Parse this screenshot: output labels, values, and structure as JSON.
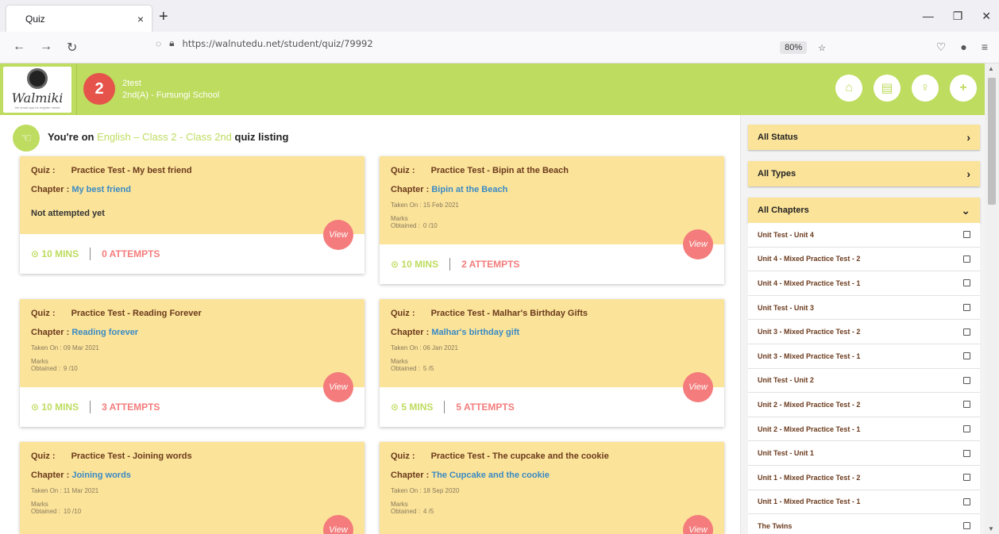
{
  "browser": {
    "tab_title": "Quiz",
    "close_glyph": "×",
    "new_tab_glyph": "+",
    "url": "https://walnutedu.net/student/quiz/79992",
    "zoom": "80%"
  },
  "header": {
    "logo_text": "Walmiki",
    "logo_tagline": "the smart app for brighter minds",
    "grade": "2",
    "student_name": "2test",
    "student_class": "2nd(A) - Fursungi School"
  },
  "breadcrumb": {
    "prefix": "You're on",
    "highlight": "English – Class 2 - Class 2nd",
    "suffix": "quiz listing"
  },
  "labels": {
    "quiz": "Quiz :",
    "chapter": "Chapter :",
    "taken_on": "Taken On :",
    "marks_line1": "Marks",
    "marks_line2": "Obtained :",
    "view": "View",
    "not_attempted": "Not attempted yet"
  },
  "quizzes": [
    {
      "title": "Practice Test - My best friend",
      "chapter": "My best friend",
      "taken_on": "",
      "marks": "",
      "mins": "⊙ 10 MINS",
      "attempts": "0 ATTEMPTS"
    },
    {
      "title": "Practice Test - Bipin at the Beach",
      "chapter": "Bipin at the Beach",
      "taken_on": "15 Feb 2021",
      "marks": "0 /10",
      "mins": "⊙ 10 MINS",
      "attempts": "2 ATTEMPTS"
    },
    {
      "title": "Practice Test - Reading Forever",
      "chapter": "Reading forever",
      "taken_on": "09 Mar 2021",
      "marks": "9 /10",
      "mins": "⊙ 10 MINS",
      "attempts": "3 ATTEMPTS"
    },
    {
      "title": "Practice Test - Malhar's Birthday Gifts",
      "chapter": "Malhar's birthday gift",
      "taken_on": "06 Jan 2021",
      "marks": "5 /5",
      "mins": "⊙ 5 MINS",
      "attempts": "5 ATTEMPTS"
    },
    {
      "title": "Practice Test - Joining words",
      "chapter": "Joining words",
      "taken_on": "11 Mar 2021",
      "marks": "10 /10",
      "mins": "",
      "attempts": ""
    },
    {
      "title": "Practice Test - The cupcake and the cookie",
      "chapter": "The Cupcake and the cookie",
      "taken_on": "18 Sep 2020",
      "marks": "4 /5",
      "mins": "",
      "attempts": ""
    }
  ],
  "filters": {
    "status": "All Status",
    "types": "All Types",
    "chapters": "All Chapters",
    "arrow_right": "›",
    "arrow_down": "⌄"
  },
  "chapter_list": [
    "Unit Test - Unit 4",
    "Unit 4 - Mixed Practice Test - 2",
    "Unit 4 - Mixed Practice Test - 1",
    "Unit Test - Unit 3",
    "Unit 3 - Mixed Practice Test - 2",
    "Unit 3 - Mixed Practice Test - 1",
    "Unit Test - Unit 2",
    "Unit 2 - Mixed Practice Test - 2",
    "Unit 2 - Mixed Practice Test - 1",
    "Unit Test - Unit 1",
    "Unit 1 - Mixed Practice Test - 2",
    "Unit 1 - Mixed Practice Test - 1",
    "The Twins"
  ],
  "colors": {
    "accent_green": "#bedc5f",
    "card_yellow": "#fbe39a",
    "badge_red": "#e5534b",
    "attempts_pink": "#f47c7c",
    "chapter_blue": "#3a8ac4"
  }
}
